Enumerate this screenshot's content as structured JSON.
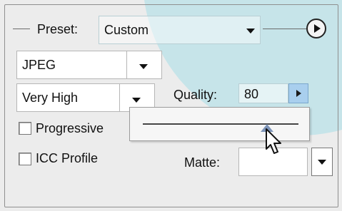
{
  "preset": {
    "label": "Preset:",
    "value": "Custom"
  },
  "format": {
    "value": "JPEG"
  },
  "compression": {
    "value": "Very High"
  },
  "quality": {
    "label": "Quality:",
    "value": "80",
    "slider_fraction": 0.8
  },
  "options": {
    "progressive_label": "Progressive",
    "progressive_checked": false,
    "icc_label": "ICC Profile",
    "icc_checked": false
  },
  "matte": {
    "label": "Matte:",
    "value": ""
  },
  "colors": {
    "panel": "#ececec",
    "accent_circle": "#bfe3e9",
    "stepper": "#a9cfee",
    "thumb": "#7d94b8"
  },
  "icons": {
    "menu": "play-circle-icon",
    "dropdown": "chevron-down-icon",
    "stepper": "chevron-right-icon",
    "slider": "slider-thumb-icon",
    "cursor": "mouse-pointer-icon"
  }
}
